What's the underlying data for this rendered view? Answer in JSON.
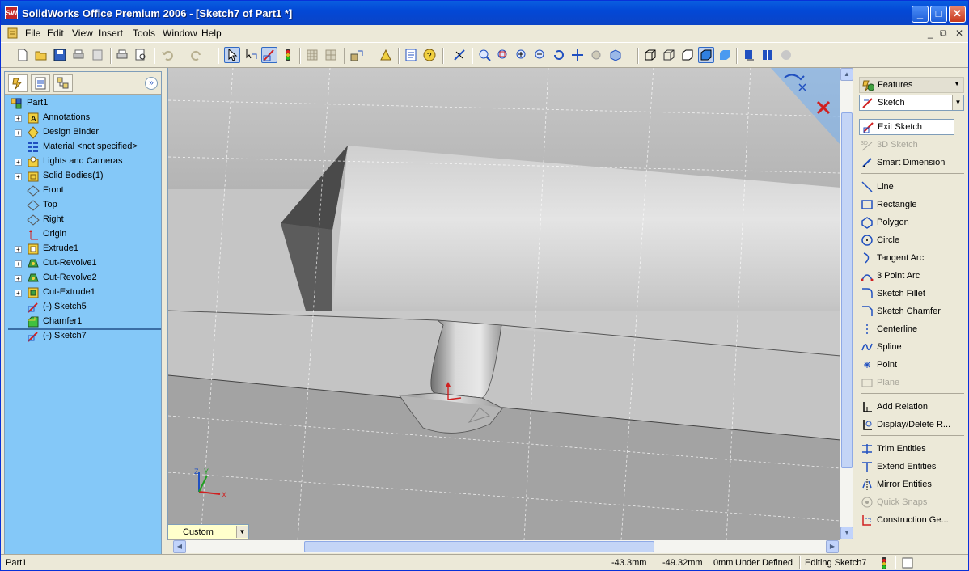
{
  "window": {
    "title": "SolidWorks Office Premium 2006 - [Sketch7 of Part1 *]",
    "app_icon_text": "SW",
    "minimize": "_",
    "maximize": "□",
    "close": "✕"
  },
  "menu": {
    "items": [
      "File",
      "Edit",
      "View",
      "Insert",
      "Tools",
      "Window",
      "Help"
    ],
    "mdi": {
      "minimize": "_",
      "restore": "⧉",
      "close": "✕"
    }
  },
  "toolbar": {
    "icons": [
      "new-icon",
      "open-icon",
      "save-icon",
      "print-icon",
      "print-preview-icon",
      "undo-icon",
      "redo-icon",
      "select-icon",
      "smart-select-icon",
      "sketch-icon",
      "rebuild-icon",
      "zoom-fit-icon",
      "zoom-area-icon",
      "zoom-in-out-icon",
      "zoom-selection-icon",
      "rotate-icon",
      "pan-icon",
      "standard-views-icon",
      "wireframe-icon",
      "hidden-lines-icon",
      "shaded-icon",
      "perspective-icon"
    ]
  },
  "feature_tree": {
    "root": "Part1",
    "items": [
      {
        "label": "Annotations",
        "icon": "annotations-icon",
        "expand": "+"
      },
      {
        "label": "Design Binder",
        "icon": "design-binder-icon",
        "expand": "+"
      },
      {
        "label": "Material <not specified>",
        "icon": "material-icon",
        "expand": ""
      },
      {
        "label": "Lights and Cameras",
        "icon": "lights-icon",
        "expand": "+"
      },
      {
        "label": "Solid Bodies(1)",
        "icon": "solid-bodies-icon",
        "expand": "+"
      },
      {
        "label": "Front",
        "icon": "plane-icon",
        "expand": ""
      },
      {
        "label": "Top",
        "icon": "plane-icon",
        "expand": ""
      },
      {
        "label": "Right",
        "icon": "plane-icon",
        "expand": ""
      },
      {
        "label": "Origin",
        "icon": "origin-icon",
        "expand": ""
      },
      {
        "label": "Extrude1",
        "icon": "extrude-icon",
        "expand": "+"
      },
      {
        "label": "Cut-Revolve1",
        "icon": "cut-revolve-icon",
        "expand": "+"
      },
      {
        "label": "Cut-Revolve2",
        "icon": "cut-revolve-icon",
        "expand": "+"
      },
      {
        "label": "Cut-Extrude1",
        "icon": "cut-extrude-icon",
        "expand": "+"
      },
      {
        "label": "(-) Sketch5",
        "icon": "sketch-icon",
        "expand": ""
      },
      {
        "label": "Chamfer1",
        "icon": "chamfer-icon",
        "expand": ""
      },
      {
        "label": "(-) Sketch7",
        "icon": "sketch-icon",
        "expand": ""
      }
    ]
  },
  "viewport": {
    "custom_view": "Custom",
    "triad": {
      "x": "X",
      "y": "Y",
      "z": "Z"
    }
  },
  "command_manager": {
    "header": "Features",
    "selector": "Sketch",
    "exit": "Exit Sketch",
    "items": [
      {
        "label": "3D Sketch",
        "icon": "3d-sketch-icon",
        "disabled": true
      },
      {
        "label": "Smart Dimension",
        "icon": "smart-dimension-icon",
        "disabled": false
      },
      {
        "label": "Line",
        "icon": "line-icon",
        "disabled": false
      },
      {
        "label": "Rectangle",
        "icon": "rectangle-icon",
        "disabled": false
      },
      {
        "label": "Polygon",
        "icon": "polygon-icon",
        "disabled": false
      },
      {
        "label": "Circle",
        "icon": "circle-icon",
        "disabled": false
      },
      {
        "label": "Tangent Arc",
        "icon": "tangent-arc-icon",
        "disabled": false
      },
      {
        "label": "3 Point Arc",
        "icon": "three-point-arc-icon",
        "disabled": false
      },
      {
        "label": "Sketch Fillet",
        "icon": "sketch-fillet-icon",
        "disabled": false
      },
      {
        "label": "Sketch Chamfer",
        "icon": "sketch-chamfer-icon",
        "disabled": false
      },
      {
        "label": "Centerline",
        "icon": "centerline-icon",
        "disabled": false
      },
      {
        "label": "Spline",
        "icon": "spline-icon",
        "disabled": false
      },
      {
        "label": "Point",
        "icon": "point-icon",
        "disabled": false
      },
      {
        "label": "Plane",
        "icon": "plane-icon",
        "disabled": true
      },
      {
        "label": "Add Relation",
        "icon": "add-relation-icon",
        "disabled": false
      },
      {
        "label": "Display/Delete R...",
        "icon": "display-delete-relations-icon",
        "disabled": false
      },
      {
        "label": "Trim Entities",
        "icon": "trim-icon",
        "disabled": false
      },
      {
        "label": "Extend Entities",
        "icon": "extend-icon",
        "disabled": false
      },
      {
        "label": "Mirror Entities",
        "icon": "mirror-icon",
        "disabled": false
      },
      {
        "label": "Quick Snaps",
        "icon": "quick-snaps-icon",
        "disabled": true
      },
      {
        "label": "Construction Ge...",
        "icon": "construction-geometry-icon",
        "disabled": false
      }
    ]
  },
  "status_bar": {
    "doc": "Part1",
    "x": "-43.3mm",
    "y": "-49.32mm",
    "z": "0mm",
    "state": "Under Defined",
    "editing": "Editing Sketch7"
  }
}
